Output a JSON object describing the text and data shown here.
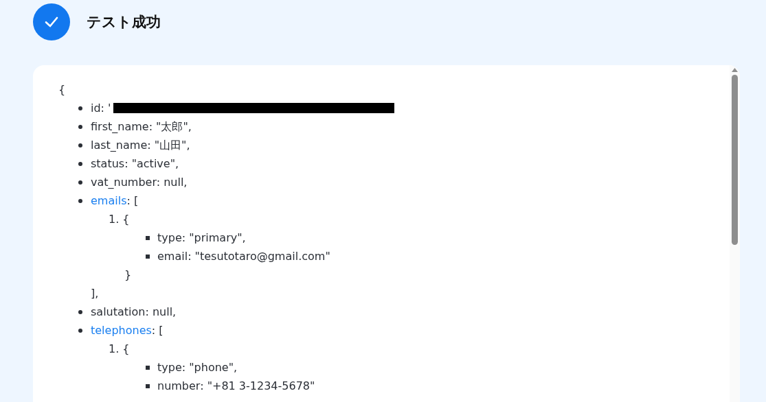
{
  "header": {
    "title": "テスト成功"
  },
  "response": {
    "open": "{",
    "fields": [
      {
        "key": "id",
        "value": ": '",
        "redacted": true
      },
      {
        "key": "first_name",
        "value": ": \"太郎\","
      },
      {
        "key": "last_name",
        "value": ": \"山田\","
      },
      {
        "key": "status",
        "value": ": \"active\","
      },
      {
        "key": "vat_number",
        "value": ": null,"
      },
      {
        "key": "emails",
        "link": true,
        "value": ": [",
        "entries": [
          {
            "number": "1.",
            "open": "{",
            "fields": [
              {
                "key": "type",
                "value": ": \"primary\","
              },
              {
                "key": "email",
                "value": ": \"tesutotaro@gmail.com\""
              }
            ],
            "close": "}"
          }
        ],
        "close": "],"
      },
      {
        "key": "salutation",
        "value": ": null,"
      },
      {
        "key": "telephones",
        "link": true,
        "value": ": [",
        "entries": [
          {
            "number": "1.",
            "open": "{",
            "fields": [
              {
                "key": "type",
                "value": ": \"phone\","
              },
              {
                "key": "number",
                "value": ": \"+81 3-1234-5678\""
              }
            ]
          }
        ]
      }
    ]
  }
}
